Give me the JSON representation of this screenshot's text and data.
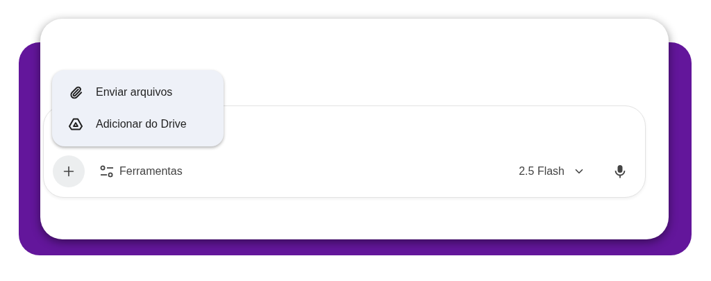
{
  "menu": {
    "items": [
      {
        "label": "Enviar arquivos"
      },
      {
        "label": "Adicionar do Drive"
      }
    ]
  },
  "composer": {
    "tools_label": "Ferramentas",
    "model": "2.5 Flash"
  }
}
